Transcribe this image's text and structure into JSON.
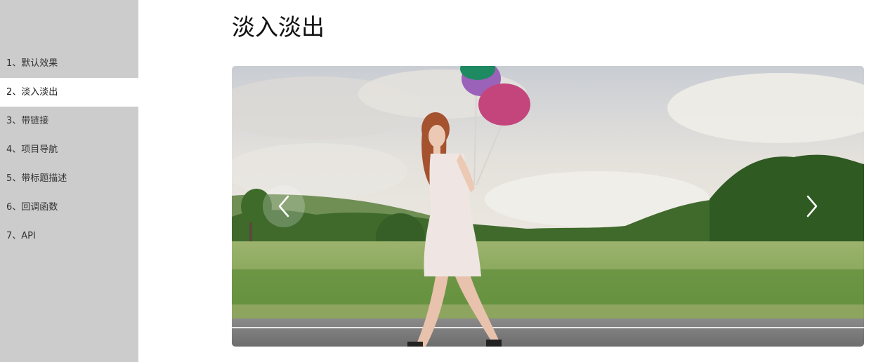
{
  "sidebar": {
    "items": [
      {
        "label": "1、默认效果"
      },
      {
        "label": "2、淡入淡出",
        "active": true
      },
      {
        "label": "3、带链接"
      },
      {
        "label": "4、项目导航"
      },
      {
        "label": "5、带标题描述"
      },
      {
        "label": "6、回调函数"
      },
      {
        "label": "7、API"
      }
    ]
  },
  "main": {
    "title": "淡入淡出"
  },
  "slider": {
    "prev_icon": "chevron-left-icon",
    "next_icon": "chevron-right-icon"
  },
  "colors": {
    "sidebar_bg": "#cccccc",
    "active_item_bg": "#ffffff"
  }
}
